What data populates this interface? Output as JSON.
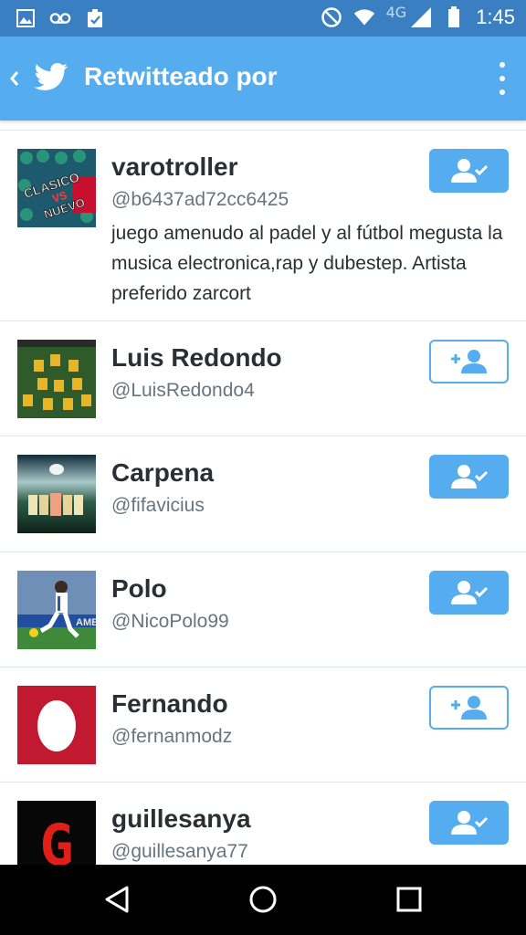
{
  "status_bar": {
    "network": "4G",
    "time": "1:45"
  },
  "app_bar": {
    "title": "Retwitteado por"
  },
  "users": [
    {
      "name": "varotroller",
      "handle": "@b6437ad72cc6425",
      "bio": "juego amenudo al padel y al fútbol megusta la musica electronica,rap y dubestep. Artista preferido zarcort",
      "following": true,
      "avatar_text": [
        "CLASICO",
        "VS",
        "NUEVO"
      ]
    },
    {
      "name": "Luis Redondo",
      "handle": "@LuisRedondo4",
      "bio": "",
      "following": false
    },
    {
      "name": "Carpena",
      "handle": "@fifavicius",
      "bio": "",
      "following": true
    },
    {
      "name": "Polo",
      "handle": "@NicoPolo99",
      "bio": "",
      "following": true,
      "avatar_text": [
        "AME"
      ]
    },
    {
      "name": "Fernando",
      "handle": "@fernanmodz",
      "bio": "",
      "following": false
    },
    {
      "name": "guillesanya",
      "handle": "@guillesanya77",
      "bio": "",
      "following": true,
      "avatar_text": [
        "G"
      ]
    }
  ],
  "colors": {
    "status_bar": "#3a7fc1",
    "app_bar": "#55acee",
    "accent": "#55acee",
    "name_text": "#292f33",
    "secondary_text": "#66757f",
    "divider": "#e1e8ed",
    "nav_bar": "#000000"
  }
}
